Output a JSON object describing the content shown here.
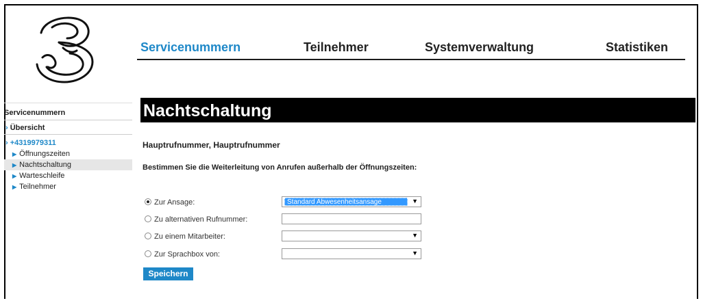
{
  "nav": {
    "tabs": [
      {
        "label": "Servicenummern",
        "active": true
      },
      {
        "label": "Teilnehmer",
        "active": false
      },
      {
        "label": "Systemverwaltung",
        "active": false
      },
      {
        "label": "Statistiken",
        "active": false
      }
    ]
  },
  "sidebar": {
    "heading": "Servicenummern",
    "overview": "Übersicht",
    "number": "+4319979311",
    "subitems": [
      "Öffnungszeiten",
      "Nachtschaltung",
      "Warteschleife",
      "Teilnehmer"
    ],
    "selected": "Nachtschaltung"
  },
  "main": {
    "title": "Nachtschaltung",
    "subtitle": "Hauptrufnummer, Hauptrufnummer",
    "instruction": "Bestimmen Sie die Weiterleitung von Anrufen außerhalb der Öffnungszeiten:",
    "options": [
      {
        "label": "Zur Ansage:",
        "checked": true,
        "field_type": "select",
        "value": "Standard Abwesenheitsansage"
      },
      {
        "label": "Zu alternativen Rufnummer:",
        "checked": false,
        "field_type": "text",
        "value": ""
      },
      {
        "label": "Zu einem Mitarbeiter:",
        "checked": false,
        "field_type": "select",
        "value": ""
      },
      {
        "label": "Zur Sprachbox von:",
        "checked": false,
        "field_type": "select",
        "value": ""
      }
    ],
    "save_label": "Speichern"
  },
  "colors": {
    "accent": "#1e88c8",
    "title_bg": "#000000"
  },
  "icons": {
    "logo": "three-logo",
    "dropdown": "dropdown-arrow-icon",
    "chevron": "chevron-right-icon"
  }
}
